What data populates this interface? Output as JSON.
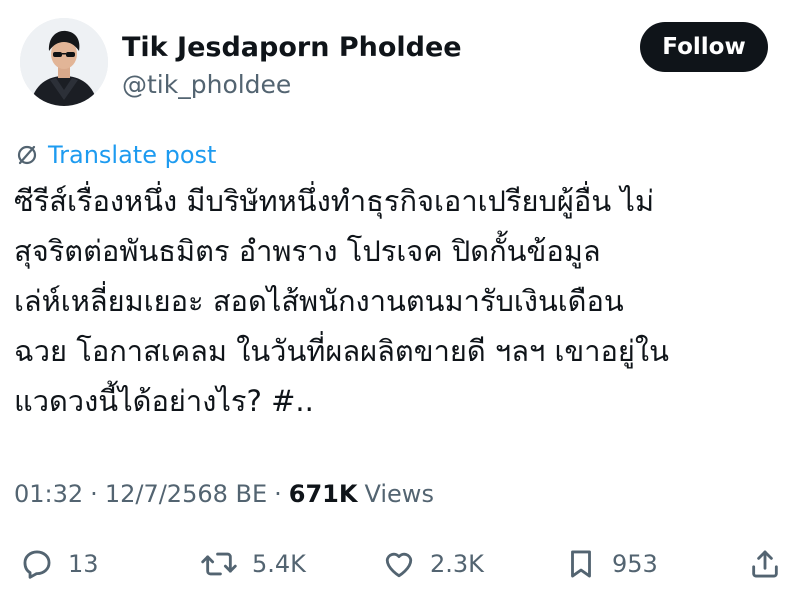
{
  "author": {
    "display_name": "Tik Jesdaporn Pholdee",
    "handle": "@tik_pholdee",
    "avatar_icon": "profile-photo"
  },
  "follow_button": {
    "label": "Follow"
  },
  "translate": {
    "label": "Translate post",
    "icon": "translate-icon",
    "color": "#1d9bf0"
  },
  "tweet": {
    "lines": [
      "ซีรีส์เรื่องหนึ่ง มีบริษัทหนึ่งทำธุรกิจเอาเปรียบผู้อื่น ไม่",
      "สุจริตต่อพันธมิตร อำพราง โปรเจค ปิดกั้นข้อมูล",
      "เล่ห์เหลี่ยมเยอะ  สอดไส้พนักงานตนมารับเงินเดือน",
      "ฉวย โอกาสเคลม ในวันที่ผลผลิตขายดี ฯลฯ เขาอยู่ใน",
      "แวดวงนี้ได้อย่างไร? #.."
    ]
  },
  "meta": {
    "time": "01:32",
    "separator": "·",
    "date": "12/7/2568 BE",
    "views_count": "671K",
    "views_label": "Views"
  },
  "actions": {
    "replies": {
      "icon": "reply-icon",
      "count": "13"
    },
    "reposts": {
      "icon": "repost-icon",
      "count": "5.4K"
    },
    "likes": {
      "icon": "heart-icon",
      "count": "2.3K"
    },
    "bookmarks": {
      "icon": "bookmark-icon",
      "count": "953"
    },
    "share": {
      "icon": "share-icon"
    }
  },
  "colors": {
    "text_primary": "#0f1419",
    "text_secondary": "#536471",
    "accent": "#1d9bf0",
    "follow_bg": "#0f1419"
  }
}
